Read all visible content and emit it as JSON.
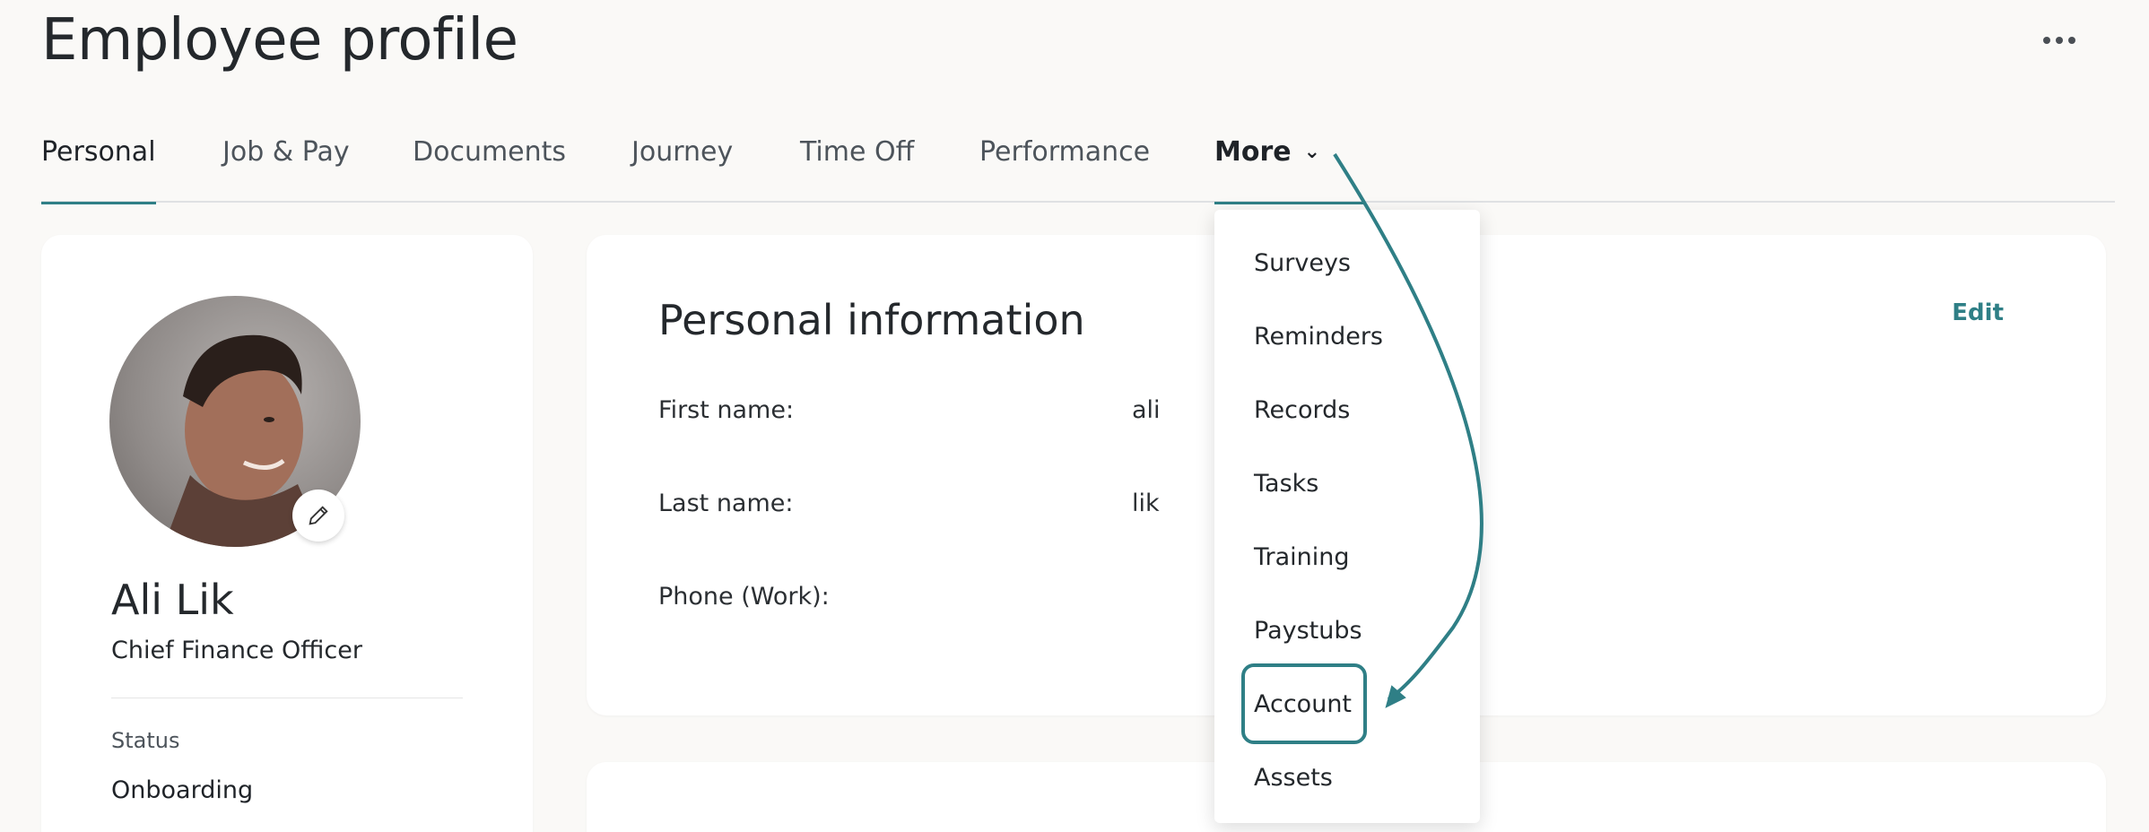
{
  "header": {
    "title": "Employee profile"
  },
  "tabs": [
    {
      "label": "Personal"
    },
    {
      "label": "Job & Pay"
    },
    {
      "label": "Documents"
    },
    {
      "label": "Journey"
    },
    {
      "label": "Time Off"
    },
    {
      "label": "Performance"
    },
    {
      "label": "More"
    }
  ],
  "profile": {
    "name": "Ali Lik",
    "role": "Chief Finance Officer",
    "status_label": "Status",
    "status_value": "Onboarding"
  },
  "personal_info": {
    "title": "Personal information",
    "edit_label": "Edit",
    "rows": [
      {
        "label": "First name:",
        "value": "ali"
      },
      {
        "label": "Last name:",
        "value": "lik"
      },
      {
        "label": "Phone (Work):",
        "value": ""
      }
    ]
  },
  "more_dropdown": {
    "items": [
      "Surveys",
      "Reminders",
      "Records",
      "Tasks",
      "Training",
      "Paystubs",
      "Account",
      "Assets"
    ],
    "highlighted": "Account"
  },
  "colors": {
    "accent": "#2f7f86",
    "background": "#faf9f7",
    "card": "#ffffff"
  },
  "icons": {
    "more_options": "more-horizontal-icon",
    "edit_photo": "pencil-icon",
    "tab_chevron": "chevron-down-icon"
  }
}
